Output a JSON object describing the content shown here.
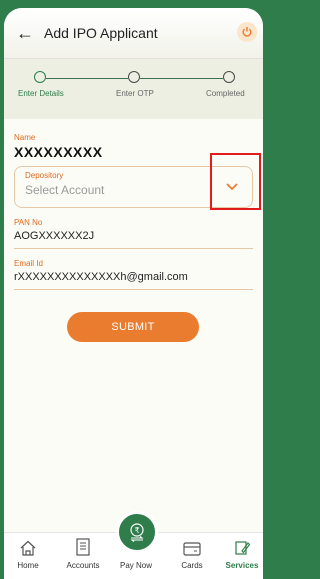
{
  "header": {
    "title": "Add IPO Applicant"
  },
  "stepper": {
    "steps": [
      {
        "label": "Enter Details",
        "active": true
      },
      {
        "label": "Enter OTP",
        "active": false
      },
      {
        "label": "Completed",
        "active": false
      }
    ]
  },
  "form": {
    "name_label": "Name",
    "name_value": "XXXXXXXXX",
    "depository_label": "Depository",
    "depository_placeholder": "Select Account",
    "pan_label": "PAN No",
    "pan_value": "AOGXXXXXX2J",
    "email_label": "Email Id",
    "email_value": "rXXXXXXXXXXXXXXh@gmail.com",
    "submit_label": "SUBMIT"
  },
  "bottom_nav": {
    "items": [
      {
        "label": "Home",
        "icon": "home-icon",
        "active": false
      },
      {
        "label": "Accounts",
        "icon": "accounts-icon",
        "active": false
      },
      {
        "label": "Pay Now",
        "icon": "rupee-transfer-icon",
        "active": false
      },
      {
        "label": "Cards",
        "icon": "card-icon",
        "active": false
      },
      {
        "label": "Services",
        "icon": "services-icon",
        "active": true
      }
    ]
  },
  "colors": {
    "brand_green": "#2f7d4a",
    "accent_orange": "#e97c2f",
    "highlight_red": "#e21b1b"
  }
}
